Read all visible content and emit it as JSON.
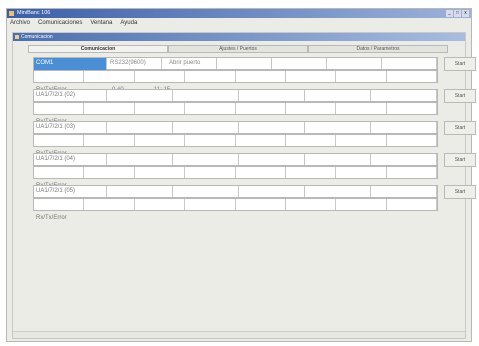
{
  "window": {
    "title": "MiniBanc 106",
    "menus": [
      "Archivo",
      "Comunicaciones",
      "Ventana",
      "Ayuda"
    ],
    "controls": [
      "_",
      "□",
      "x"
    ]
  },
  "child_window": {
    "title": "Comunicacion"
  },
  "tabs": [
    {
      "label": "Comunicacion",
      "active": true
    },
    {
      "label": "Ajustes / Puertos",
      "active": false
    },
    {
      "label": "Datos / Parametros",
      "active": false
    }
  ],
  "rows": [
    {
      "name": "COM1",
      "selected": true,
      "port_value": "RS232(9600)",
      "detail": "Abrir puerto",
      "status": "Rx/Tx/Error",
      "status_extra": "0  #0",
      "status_extra2": "11:  15",
      "button": "Start"
    },
    {
      "name": "UA1/7/2/1 (02)",
      "selected": false,
      "port_value": "",
      "detail": "",
      "status": "Rx/Tx/Error",
      "status_extra": "",
      "status_extra2": "",
      "button": "Start"
    },
    {
      "name": "UA1/7/2/1 (03)",
      "selected": false,
      "port_value": "",
      "detail": "",
      "status": "Rx/Tx/Error",
      "status_extra": "",
      "status_extra2": "",
      "button": "Start"
    },
    {
      "name": "UA1/7/2/1 (04)",
      "selected": false,
      "port_value": "",
      "detail": "",
      "status": "Rx/Tx/Error",
      "status_extra": "",
      "status_extra2": "",
      "button": "Start"
    },
    {
      "name": "UA1/7/2/1 (05)",
      "selected": false,
      "port_value": "",
      "detail": "",
      "status": "Rx/Tx/Error",
      "status_extra": "",
      "status_extra2": "",
      "button": "Start"
    }
  ]
}
